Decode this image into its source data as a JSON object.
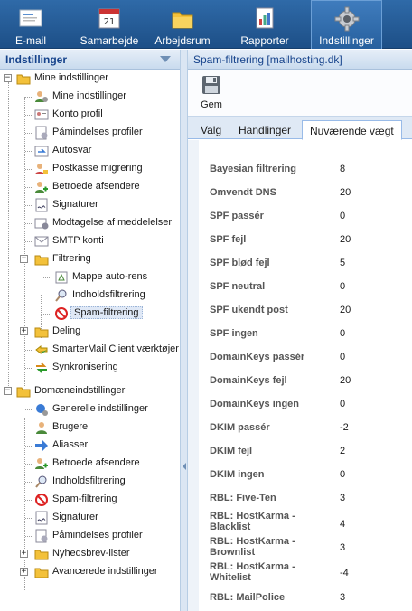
{
  "topnav": {
    "items": [
      {
        "label": "E-mail",
        "icon": "email-icon"
      },
      {
        "label": "Samarbejde",
        "icon": "calendar-icon"
      },
      {
        "label": "Arbejdsrum",
        "icon": "folder-icon"
      },
      {
        "label": "Rapporter",
        "icon": "report-icon"
      },
      {
        "label": "Indstillinger",
        "icon": "gear-icon",
        "active": true
      }
    ]
  },
  "left": {
    "title": "Indstillinger",
    "tree": [
      {
        "label": "Mine indstillinger",
        "icon": "folder-icon"
      },
      {
        "label": "Mine indstillinger",
        "icon": "user-gear-icon"
      },
      {
        "label": "Konto profil",
        "icon": "profile-card-icon"
      },
      {
        "label": "Påmindelses profiler",
        "icon": "reminder-icon"
      },
      {
        "label": "Autosvar",
        "icon": "autoreply-icon"
      },
      {
        "label": "Postkasse migrering",
        "icon": "migrate-icon"
      },
      {
        "label": "Betroede afsendere",
        "icon": "trusted-user-icon"
      },
      {
        "label": "Signaturer",
        "icon": "signature-icon"
      },
      {
        "label": "Modtagelse af meddelelser",
        "icon": "notification-icon"
      },
      {
        "label": "SMTP konti",
        "icon": "smtp-icon"
      },
      {
        "label": "Filtrering",
        "icon": "folder-icon"
      },
      {
        "label": "Mappe auto-rens",
        "icon": "auto-clean-icon"
      },
      {
        "label": "Indholdsfiltrering",
        "icon": "magnifier-icon"
      },
      {
        "label": "Spam-filtrering",
        "icon": "no-entry-icon"
      },
      {
        "label": "Deling",
        "icon": "folder-icon"
      },
      {
        "label": "SmarterMail Client værktøjer",
        "icon": "tools-icon"
      },
      {
        "label": "Synkronisering",
        "icon": "sync-icon"
      },
      {
        "label": "Domæneindstillinger",
        "icon": "folder-icon"
      },
      {
        "label": "Generelle indstillinger",
        "icon": "globe-gear-icon"
      },
      {
        "label": "Brugere",
        "icon": "user-icon"
      },
      {
        "label": "Aliasser",
        "icon": "arrow-right-icon"
      },
      {
        "label": "Betroede afsendere",
        "icon": "trusted-user-icon"
      },
      {
        "label": "Indholdsfiltrering",
        "icon": "magnifier-icon"
      },
      {
        "label": "Spam-filtrering",
        "icon": "no-entry-icon"
      },
      {
        "label": "Signaturer",
        "icon": "signature-icon"
      },
      {
        "label": "Påmindelses profiler",
        "icon": "reminder-icon"
      },
      {
        "label": "Nyhedsbrev-lister",
        "icon": "folder-icon"
      },
      {
        "label": "Avancerede indstillinger",
        "icon": "folder-icon"
      }
    ]
  },
  "right": {
    "title": "Spam-filtrering [mailhosting.dk]",
    "toolbar": {
      "save_label": "Gem",
      "save_icon": "floppy-disk-icon"
    },
    "tabs": [
      {
        "label": "Valg"
      },
      {
        "label": "Handlinger"
      },
      {
        "label": "Nuværende vægt",
        "active": true
      }
    ],
    "weights": [
      {
        "label": "Bayesian filtrering",
        "value": "8"
      },
      {
        "label": "Omvendt DNS",
        "value": "20"
      },
      {
        "label": "SPF passér",
        "value": "0"
      },
      {
        "label": "SPF fejl",
        "value": "20"
      },
      {
        "label": "SPF blød fejl",
        "value": "5"
      },
      {
        "label": "SPF neutral",
        "value": "0"
      },
      {
        "label": "SPF ukendt post",
        "value": "20"
      },
      {
        "label": "SPF ingen",
        "value": "0"
      },
      {
        "label": "DomainKeys passér",
        "value": "0"
      },
      {
        "label": "DomainKeys fejl",
        "value": "20"
      },
      {
        "label": "DomainKeys ingen",
        "value": "0"
      },
      {
        "label": "DKIM passér",
        "value": "-2"
      },
      {
        "label": "DKIM fejl",
        "value": "2"
      },
      {
        "label": "DKIM ingen",
        "value": "0"
      },
      {
        "label": "RBL: Five-Ten",
        "value": "3"
      },
      {
        "label": "RBL: HostKarma - Blacklist",
        "value": "4"
      },
      {
        "label": "RBL: HostKarma - Brownlist",
        "value": "3"
      },
      {
        "label": "RBL: HostKarma - Whitelist",
        "value": "-4"
      },
      {
        "label": "RBL: MailPolice",
        "value": "3"
      }
    ]
  },
  "colors": {
    "nav": "#1d4f87",
    "panel_header": "#c9dbee",
    "header_text": "#15428b"
  }
}
